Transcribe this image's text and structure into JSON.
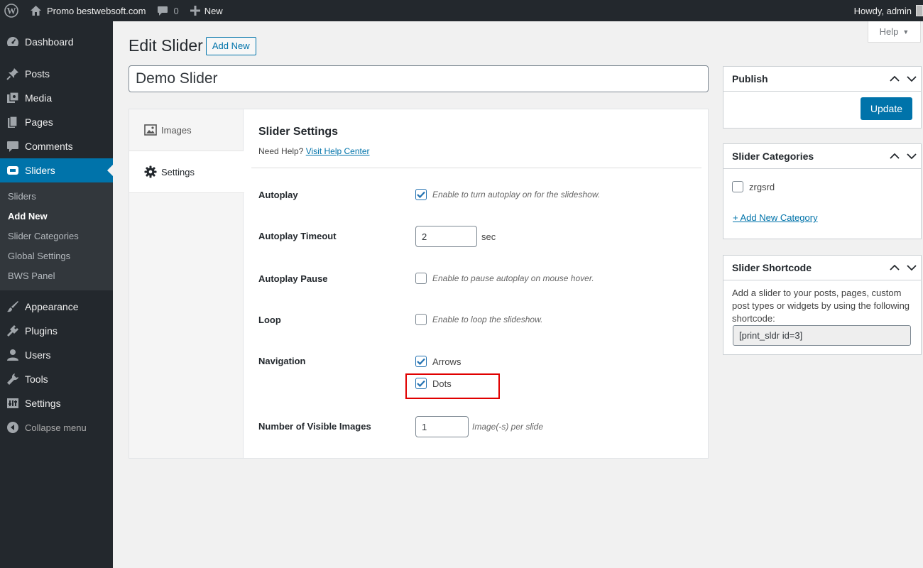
{
  "adminbar": {
    "site_name": "Promo bestwebsoft.com",
    "comments_count": "0",
    "new_label": "New",
    "greeting": "Howdy, admin"
  },
  "sidebar": {
    "items": [
      {
        "label": "Dashboard",
        "icon": "dashboard-icon"
      },
      {
        "label": "Posts",
        "icon": "pin-icon"
      },
      {
        "label": "Media",
        "icon": "media-icon"
      },
      {
        "label": "Pages",
        "icon": "pages-icon"
      },
      {
        "label": "Comments",
        "icon": "comment-icon"
      },
      {
        "label": "Sliders",
        "icon": "slider-icon"
      },
      {
        "label": "Appearance",
        "icon": "brush-icon"
      },
      {
        "label": "Plugins",
        "icon": "plug-icon"
      },
      {
        "label": "Users",
        "icon": "user-icon"
      },
      {
        "label": "Tools",
        "icon": "wrench-icon"
      },
      {
        "label": "Settings",
        "icon": "settings-icon"
      }
    ],
    "submenu": [
      "Sliders",
      "Add New",
      "Slider Categories",
      "Global Settings",
      "BWS Panel"
    ],
    "collapse_label": "Collapse menu"
  },
  "help_tab": "Help",
  "page": {
    "title": "Edit Slider",
    "add_new": "Add New",
    "slider_title": "Demo Slider"
  },
  "tabs": [
    {
      "label": "Images",
      "icon": "image-icon"
    },
    {
      "label": "Settings",
      "icon": "gear-icon"
    }
  ],
  "settings": {
    "heading": "Slider Settings",
    "need_help": "Need Help?",
    "help_link": "Visit Help Center",
    "autoplay": {
      "label": "Autoplay",
      "desc": "Enable to turn autoplay on for the slideshow.",
      "checked": true
    },
    "timeout": {
      "label": "Autoplay Timeout",
      "value": "2",
      "unit": "sec"
    },
    "pause": {
      "label": "Autoplay Pause",
      "desc": "Enable to pause autoplay on mouse hover.",
      "checked": false
    },
    "loop": {
      "label": "Loop",
      "desc": "Enable to loop the slideshow.",
      "checked": false
    },
    "navigation": {
      "label": "Navigation",
      "arrows": "Arrows",
      "dots": "Dots"
    },
    "visible": {
      "label": "Number of Visible Images",
      "value": "1",
      "unit": "Image(-s) per slide"
    }
  },
  "publish": {
    "title": "Publish",
    "update": "Update"
  },
  "categories": {
    "title": "Slider Categories",
    "item": "zrgsrd",
    "add": "+ Add New Category"
  },
  "shortcode": {
    "title": "Slider Shortcode",
    "text": "Add a slider to your posts, pages, custom post types or widgets by using the following shortcode:",
    "code": "[print_sldr id=3]"
  },
  "colors": {
    "accent": "#0073aa",
    "sidebar": "#23282d",
    "highlight": "#e00000"
  }
}
